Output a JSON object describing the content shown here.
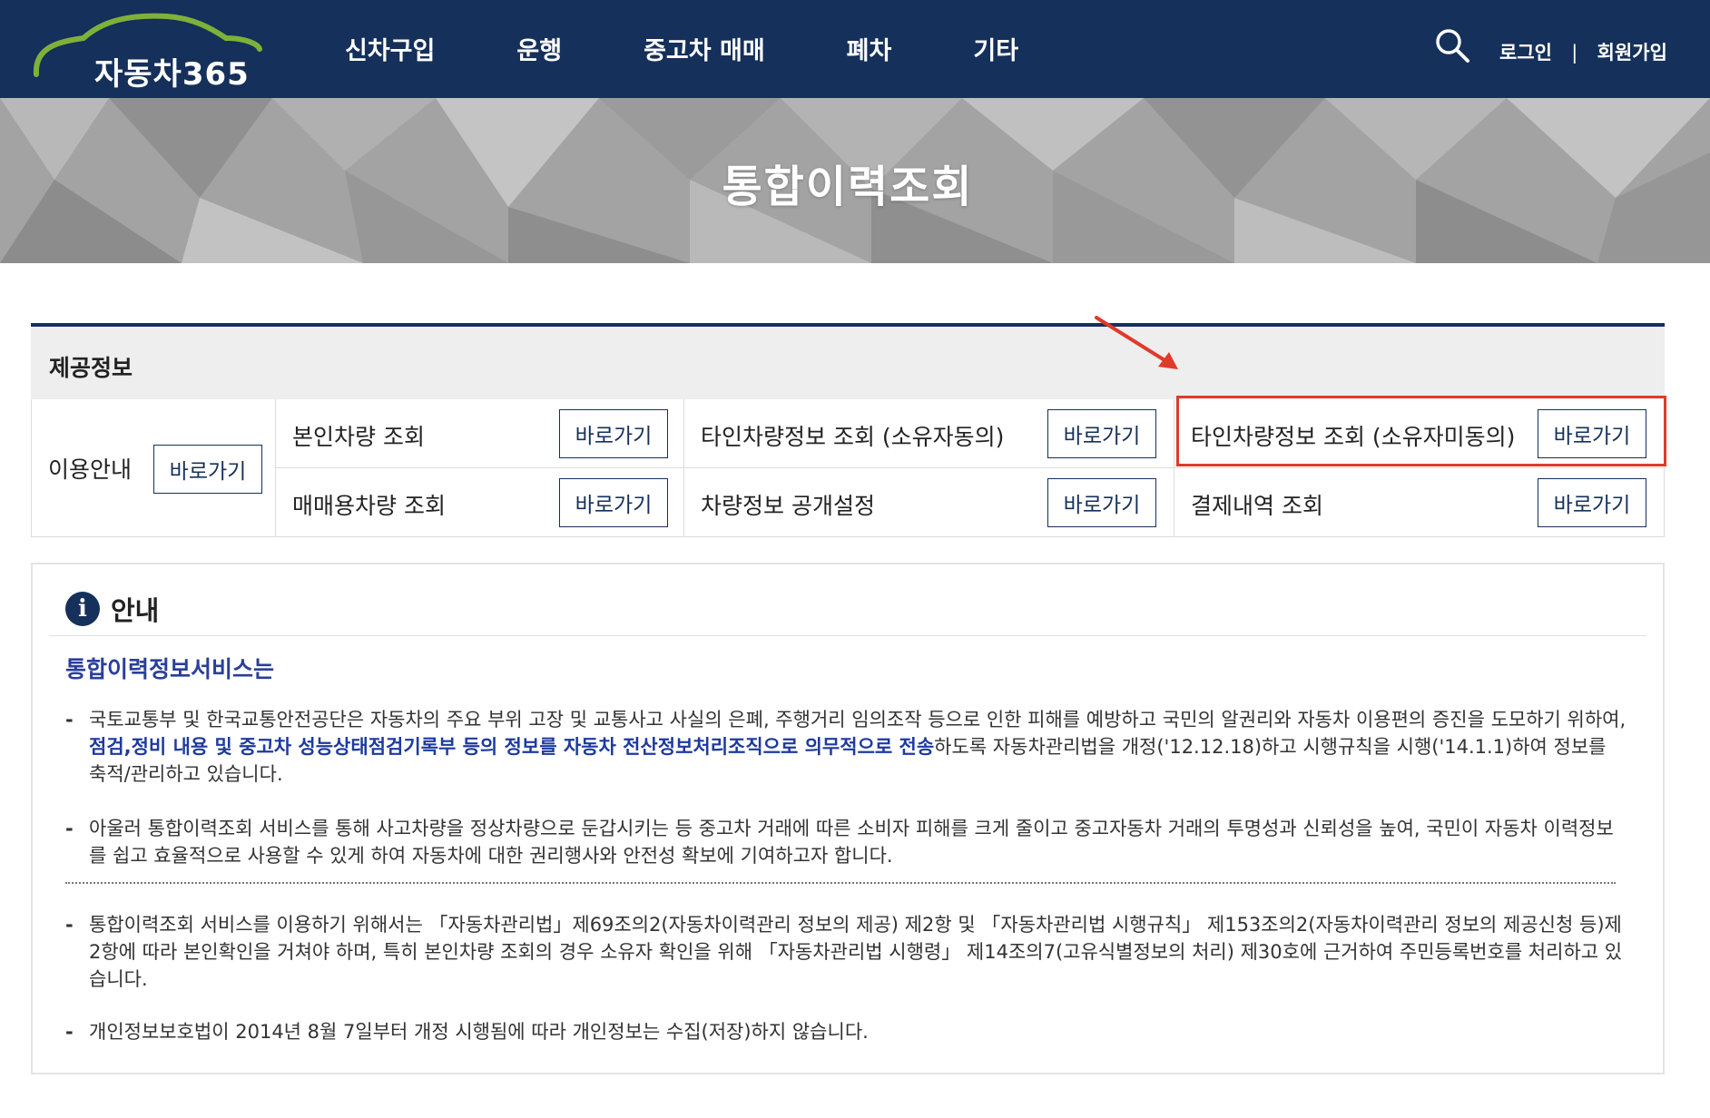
{
  "header": {
    "logo_text": "자동차365",
    "nav": [
      "신차구입",
      "운행",
      "중고차 매매",
      "폐차",
      "기타"
    ],
    "login": "로그인",
    "separator": "|",
    "signup": "회원가입"
  },
  "banner": {
    "title": "통합이력조회"
  },
  "provided_info": {
    "title": "제공정보",
    "usage_guide": "이용안내",
    "go_label": "바로가기",
    "items": [
      "본인차량 조회",
      "타인차량정보 조회 (소유자동의)",
      "타인차량정보 조회 (소유자미동의)",
      "매매용차량 조회",
      "차량정보 공개설정",
      "결제내역 조회"
    ]
  },
  "notice": {
    "icon_letter": "i",
    "title": "안내",
    "subtitle": "통합이력정보서비스는",
    "dash": "-",
    "p1_a": "국토교통부 및 한국교통안전공단은 자동차의 주요 부위 고장 및 교통사고 사실의 은폐, 주행거리 임의조작 등으로 인한 피해를 예방하고 국민의 알권리와 자동차 이용편의 증진을 도모하기 위하여, ",
    "p1_em": "점검,정비 내용 및 중고차 성능상태점검기록부 등의 정보를 자동차 전산정보처리조직으로 의무적으로 전송",
    "p1_b": "하도록 자동차관리법을 개정('12.12.18)하고 시행규칙을 시행('14.1.1)하여 정보를 축적/관리하고 있습니다.",
    "p2": "아울러 통합이력조회 서비스를 통해 사고차량을 정상차량으로 둔갑시키는 등 중고차 거래에 따른 소비자 피해를 크게 줄이고 중고자동차 거래의 투명성과 신뢰성을 높여, 국민이 자동차 이력정보를 쉽고 효율적으로 사용할 수 있게 하여 자동차에 대한 권리행사와 안전성 확보에 기여하고자 합니다.",
    "p3": "통합이력조회 서비스를 이용하기 위해서는 「자동차관리법」제69조의2(자동차이력관리 정보의 제공) 제2항 및 「자동차관리법 시행규칙」 제153조의2(자동차이력관리 정보의 제공신청 등)제2항에 따라 본인확인을 거쳐야 하며, 특히 본인차량 조회의 경우 소유자 확인을 위해 「자동차관리법 시행령」 제14조의7(고유식별정보의 처리) 제30호에 근거하여 주민등록번호를 처리하고 있습니다.",
    "p4": "개인정보보호법이 2014년 8월 7일부터 개정 시행됨에 따라 개인정보는 수집(저장)하지 않습니다."
  },
  "colors": {
    "navy": "#15305a",
    "accent_blue": "#2a3f9a",
    "highlight_red": "#e03a2a"
  }
}
